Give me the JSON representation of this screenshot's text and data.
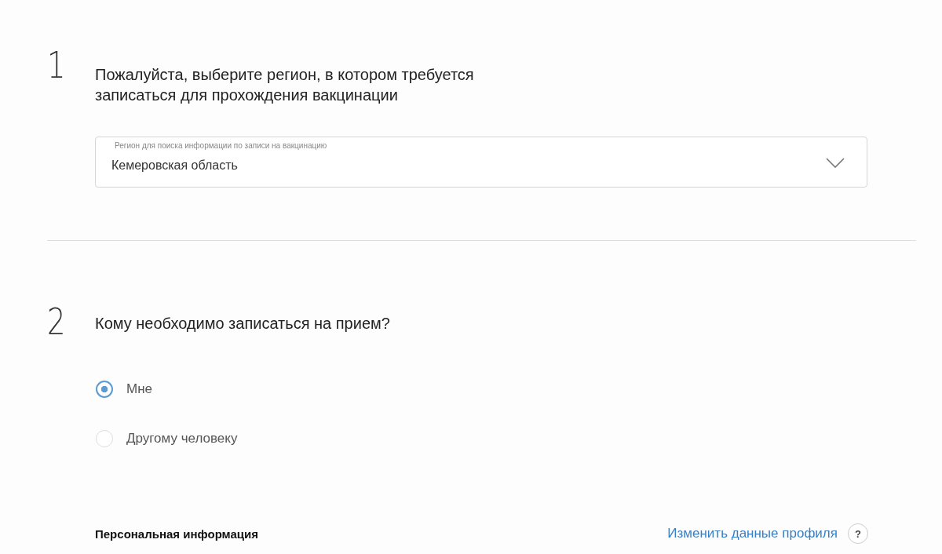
{
  "steps": [
    {
      "number": "1",
      "title": "Пожалуйста, выберите регион, в котором требуется\nзаписаться для прохождения вакцинации",
      "kind": "select",
      "select": {
        "label": "Регион для поиска информации по записи на вакцинацию",
        "value": "Кемеровская область"
      }
    },
    {
      "number": "2",
      "title": "Кому необходимо записаться на прием?",
      "kind": "radio",
      "options": [
        {
          "label": "Мне",
          "selected": true
        },
        {
          "label": "Другому человеку",
          "selected": false
        }
      ]
    }
  ],
  "personal": {
    "title": "Персональная информация",
    "link": "Изменить данные профиля",
    "help": "?"
  }
}
